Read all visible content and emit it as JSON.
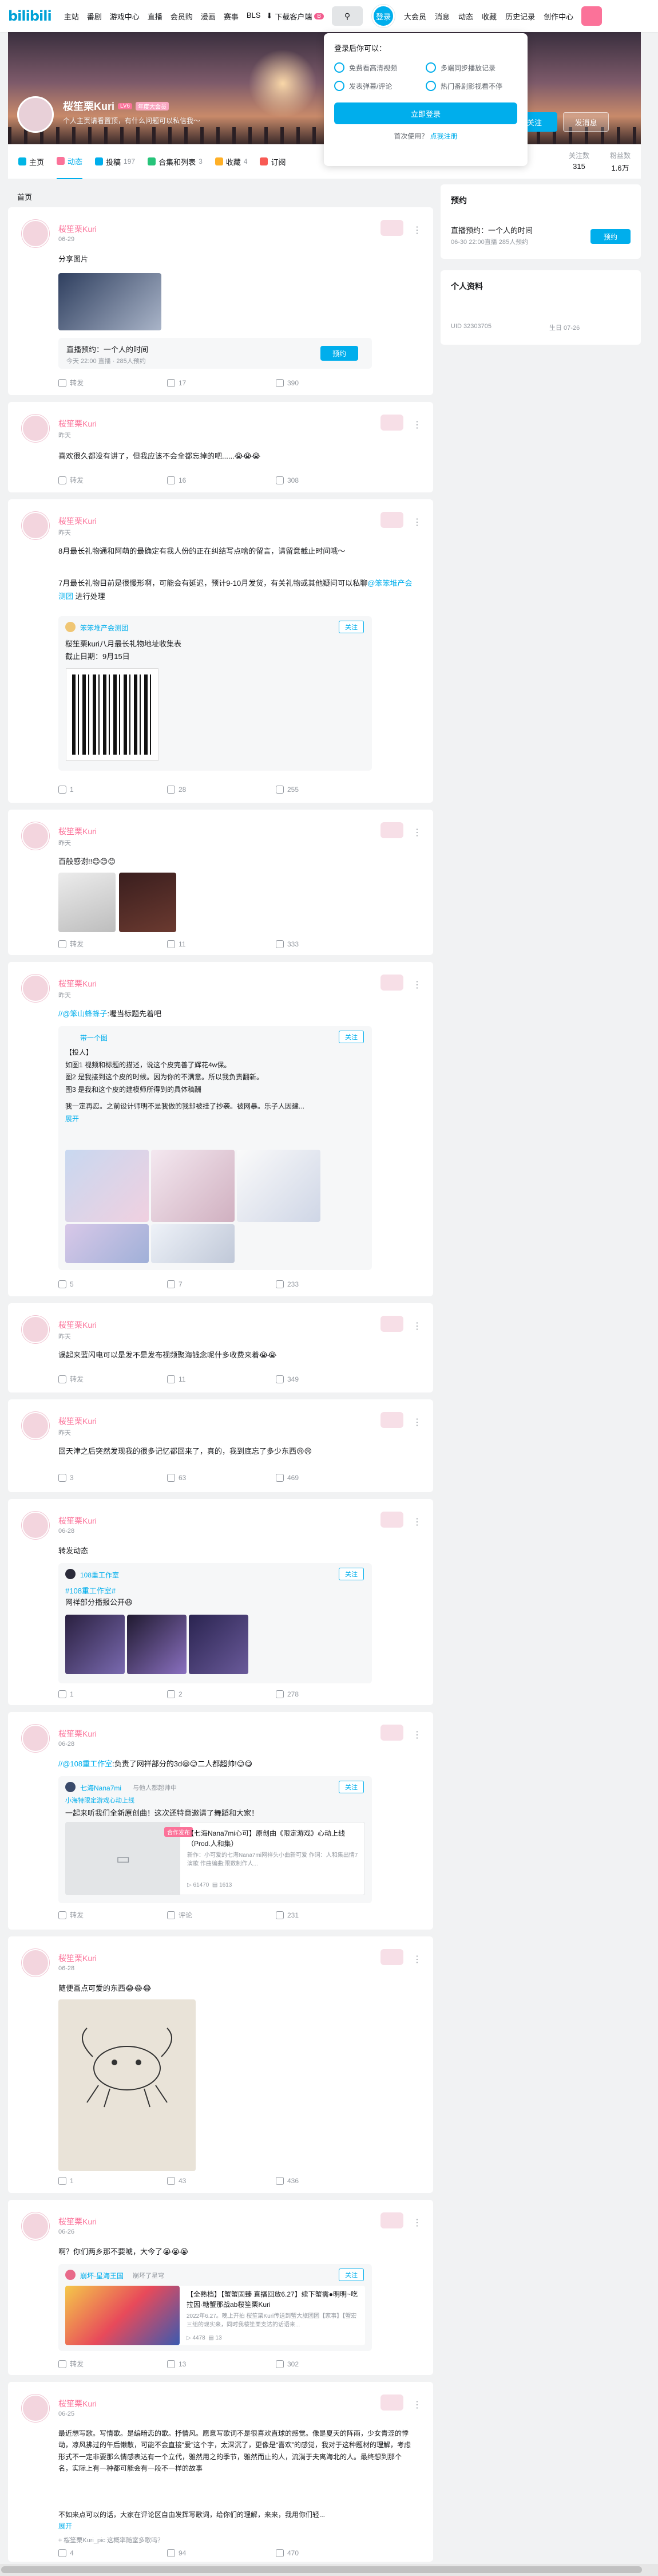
{
  "topbar": {
    "logo": "bilibili",
    "nav": [
      "主站",
      "番剧",
      "游戏中心",
      "直播",
      "会员购",
      "漫画",
      "赛事",
      "BLS"
    ],
    "download_label": "下载客户端",
    "download_badge": "B",
    "login_label": "登录",
    "right_nav": [
      "大会员",
      "消息",
      "动态",
      "收藏",
      "历史记录",
      "创作中心"
    ]
  },
  "login_popup": {
    "title": "登录后你可以：",
    "perks": [
      "免费看高清视频",
      "多端同步播放记录",
      "发表弹幕/评论",
      "热门番剧影视看不停"
    ],
    "login_button": "立即登录",
    "first_use": "首次使用？",
    "register": "点我注册"
  },
  "profile": {
    "name": "桜笙栗Kuri",
    "level": "LV6",
    "vip": "年度大会员",
    "sign": "个人主页请看置顶，有什么问题可以私信我～",
    "follow_label": "关注",
    "message_label": "发消息"
  },
  "tabs": [
    {
      "label": "主页",
      "count": ""
    },
    {
      "label": "动态",
      "count": ""
    },
    {
      "label": "投稿",
      "count": "197"
    },
    {
      "label": "合集和列表",
      "count": "3"
    },
    {
      "label": "收藏",
      "count": "4"
    },
    {
      "label": "订阅",
      "count": ""
    }
  ],
  "stats": [
    {
      "label": "关注数",
      "value": "315"
    },
    {
      "label": "粉丝数",
      "value": "1.6万"
    }
  ],
  "feed_title": "首页",
  "side": {
    "reserve_title": "预约",
    "reserve_item": "直播预约：一个人的时间",
    "reserve_meta": "06-30 22:00直播 285人预约",
    "reserve_btn": "预约",
    "info_title": "个人资料",
    "uid": "UID  32303705",
    "birthday": "生日  07-26"
  },
  "posts": [
    {
      "name": "桜笙栗Kuri",
      "time": "06-29",
      "text": "分享图片",
      "sub_title": "直播预约：一个人的时间",
      "sub_meta": "今天 22:00 直播 · 285人预约",
      "sub_btn": "预约",
      "share": "转发",
      "comment": "17",
      "like": "390"
    },
    {
      "name": "桜笙栗Kuri",
      "time": "昨天",
      "text": "喜欢很久都没有讲了，但我应该不会全都忘掉的吧......😭😭😭",
      "share": "转发",
      "comment": "16",
      "like": "308"
    },
    {
      "name": "桜笙栗Kuri",
      "time": "昨天",
      "text1": "8月最长礼物通和阿萌的最确定有我人份的正在纠结写点啥的留言，请留意截止时间哦～",
      "text2": "7月最长礼物目前是很慢形啊，可能会有延迟，预计9-10月发货，有关礼物或其他疑问可以私聊",
      "text2_link": "@笨笨堆产会测团",
      "text2_tail": "进行处理",
      "sub_name": "笨笨堆产会测团",
      "sub_follow": "关注",
      "sub_text": "桜笙栗kuri八月最长礼物地址收集表",
      "sub_deadline": "截止日期：9月15日",
      "share": "1",
      "comment": "28",
      "like": "255"
    },
    {
      "name": "桜笙栗Kuri",
      "time": "昨天",
      "text": "百般感谢!!😊😊😊",
      "share": "转发",
      "comment": "11",
      "like": "333"
    },
    {
      "name": "桜笙栗Kuri",
      "time": "昨天",
      "text_link": "//@笨山蜂蜂子",
      "text": ":喔当标题先着吧",
      "sub_name": "带一个图",
      "sub_follow": "关注",
      "sub_text1": "【投人】",
      "sub_text2": "如图1 视频和标题的描述，说这个皮完善了辉花4w保。",
      "sub_text3": "图2 是我接到这个皮的时候。因为你的不满意。所以我负责翻新。",
      "sub_text4": "图3 是我和这个皮的建模师所得到的具体稿酬",
      "sub_text5": "我一定再忍。之前设计师明不是我做的我却被挂了抄袭。被网暴。乐子人因建...",
      "sub_more": "展开",
      "share": "5",
      "comment": "7",
      "like": "233"
    },
    {
      "name": "桜笙栗Kuri",
      "time": "昨天",
      "text": "误起来蓝闪电可以是发不是发布视频聚海钱念呢什多收费来着😭😭",
      "share": "转发",
      "comment": "11",
      "like": "349"
    },
    {
      "name": "桜笙栗Kuri",
      "time": "昨天",
      "text": "回天津之后突然发现我的很多记忆都回来了，真的，我到底忘了多少东西😢😢",
      "share": "3",
      "comment": "63",
      "like": "469"
    },
    {
      "name": "桜笙栗Kuri",
      "time": "06-28",
      "text": "转发动态",
      "sub_name": "108重工作室",
      "sub_follow": "关注",
      "sub_link": "#108重工作室#",
      "sub_text": "网祥部分播报公开😆",
      "share": "1",
      "comment": "2",
      "like": "278"
    },
    {
      "name": "桜笙栗Kuri",
      "time": "06-28",
      "text_link": "//@108重工作室",
      "text": ":负责了网祥部分的3d😆😊二人都超帅!😊😋",
      "sub_name": "七海Nana7mi",
      "sub_tag": "与他人都超帅中",
      "sub_follow": "关注",
      "sub_game": "小海特限定游戏心动上线",
      "sub_text": "一起来听我们全新原创曲！这次还特意邀请了舞蹈和大家！",
      "video_title": "【七海Nana7mi心可】原创曲《限定游戏》心动上线（Prod.人和集）",
      "video_desc": "新作：小可爱的七海Nana7mi网祥头小曲新可爱 作词：人和集出情7 演歌 作曲编曲:限数制作人...",
      "video_views": "61470",
      "video_danmaku": "1613",
      "video_badge": "合作发布",
      "share": "转发",
      "comment": "评论",
      "like": "231"
    },
    {
      "name": "桜笙栗Kuri",
      "time": "06-28",
      "text": "随便画点可爱的东西😂😂😂",
      "share": "1",
      "comment": "43",
      "like": "436"
    },
    {
      "name": "桜笙栗Kuri",
      "time": "06-26",
      "text": "啊？你们两乡那不要唬，大今了😭😭😭",
      "sub_name": "崩坏·星海王国",
      "sub_tag": "崩坏了星穹",
      "sub_follow": "关注",
      "video_title": "【全熟档】【蟹蟹固臻 直播回放6.27】续下蟹需●明明~吃拉因·糖蟹那战ab桜笙栗Kuri",
      "video_desc": "2022年6.27。晚上开拍 桜笙栗Kuri传送到蟹大旅团团【家事】【蟹宏三组的现实来，同时我桜笙栗支达的话语来...",
      "video_views": "4478",
      "video_danmaku": "13",
      "share": "转发",
      "comment": "13",
      "like": "302"
    },
    {
      "name": "桜笙栗Kuri",
      "time": "06-25",
      "text": "最近想写歌。写情歌。是编暗恋的歌。抒情风。愿意写歌词不是很喜欢直球的感觉。像是夏天的阵雨，少女青涩的悸动，凉风拂过的午后懒散，可能不会直接“爱”这个字，太深沉了，更像是“喜欢”的感觉，我对于这种题材的理解，考虑形式不一定非要那么情感表达有一个立代，雅然用之的季节，雅然而止的人，流淌于夫离海北的人。最终想到那个名，实际上有一种都可能会有一段不一样的故事",
      "text_more": "不如来点可以的话，大家在评论区自由发挥写歌词，给你们的理解，来来，我用你们轻...",
      "more": "展开",
      "tag": "桜笙栗Kuri_pic 这概率随室多歌吗？",
      "share": "4",
      "comment": "94",
      "like": "470"
    }
  ]
}
